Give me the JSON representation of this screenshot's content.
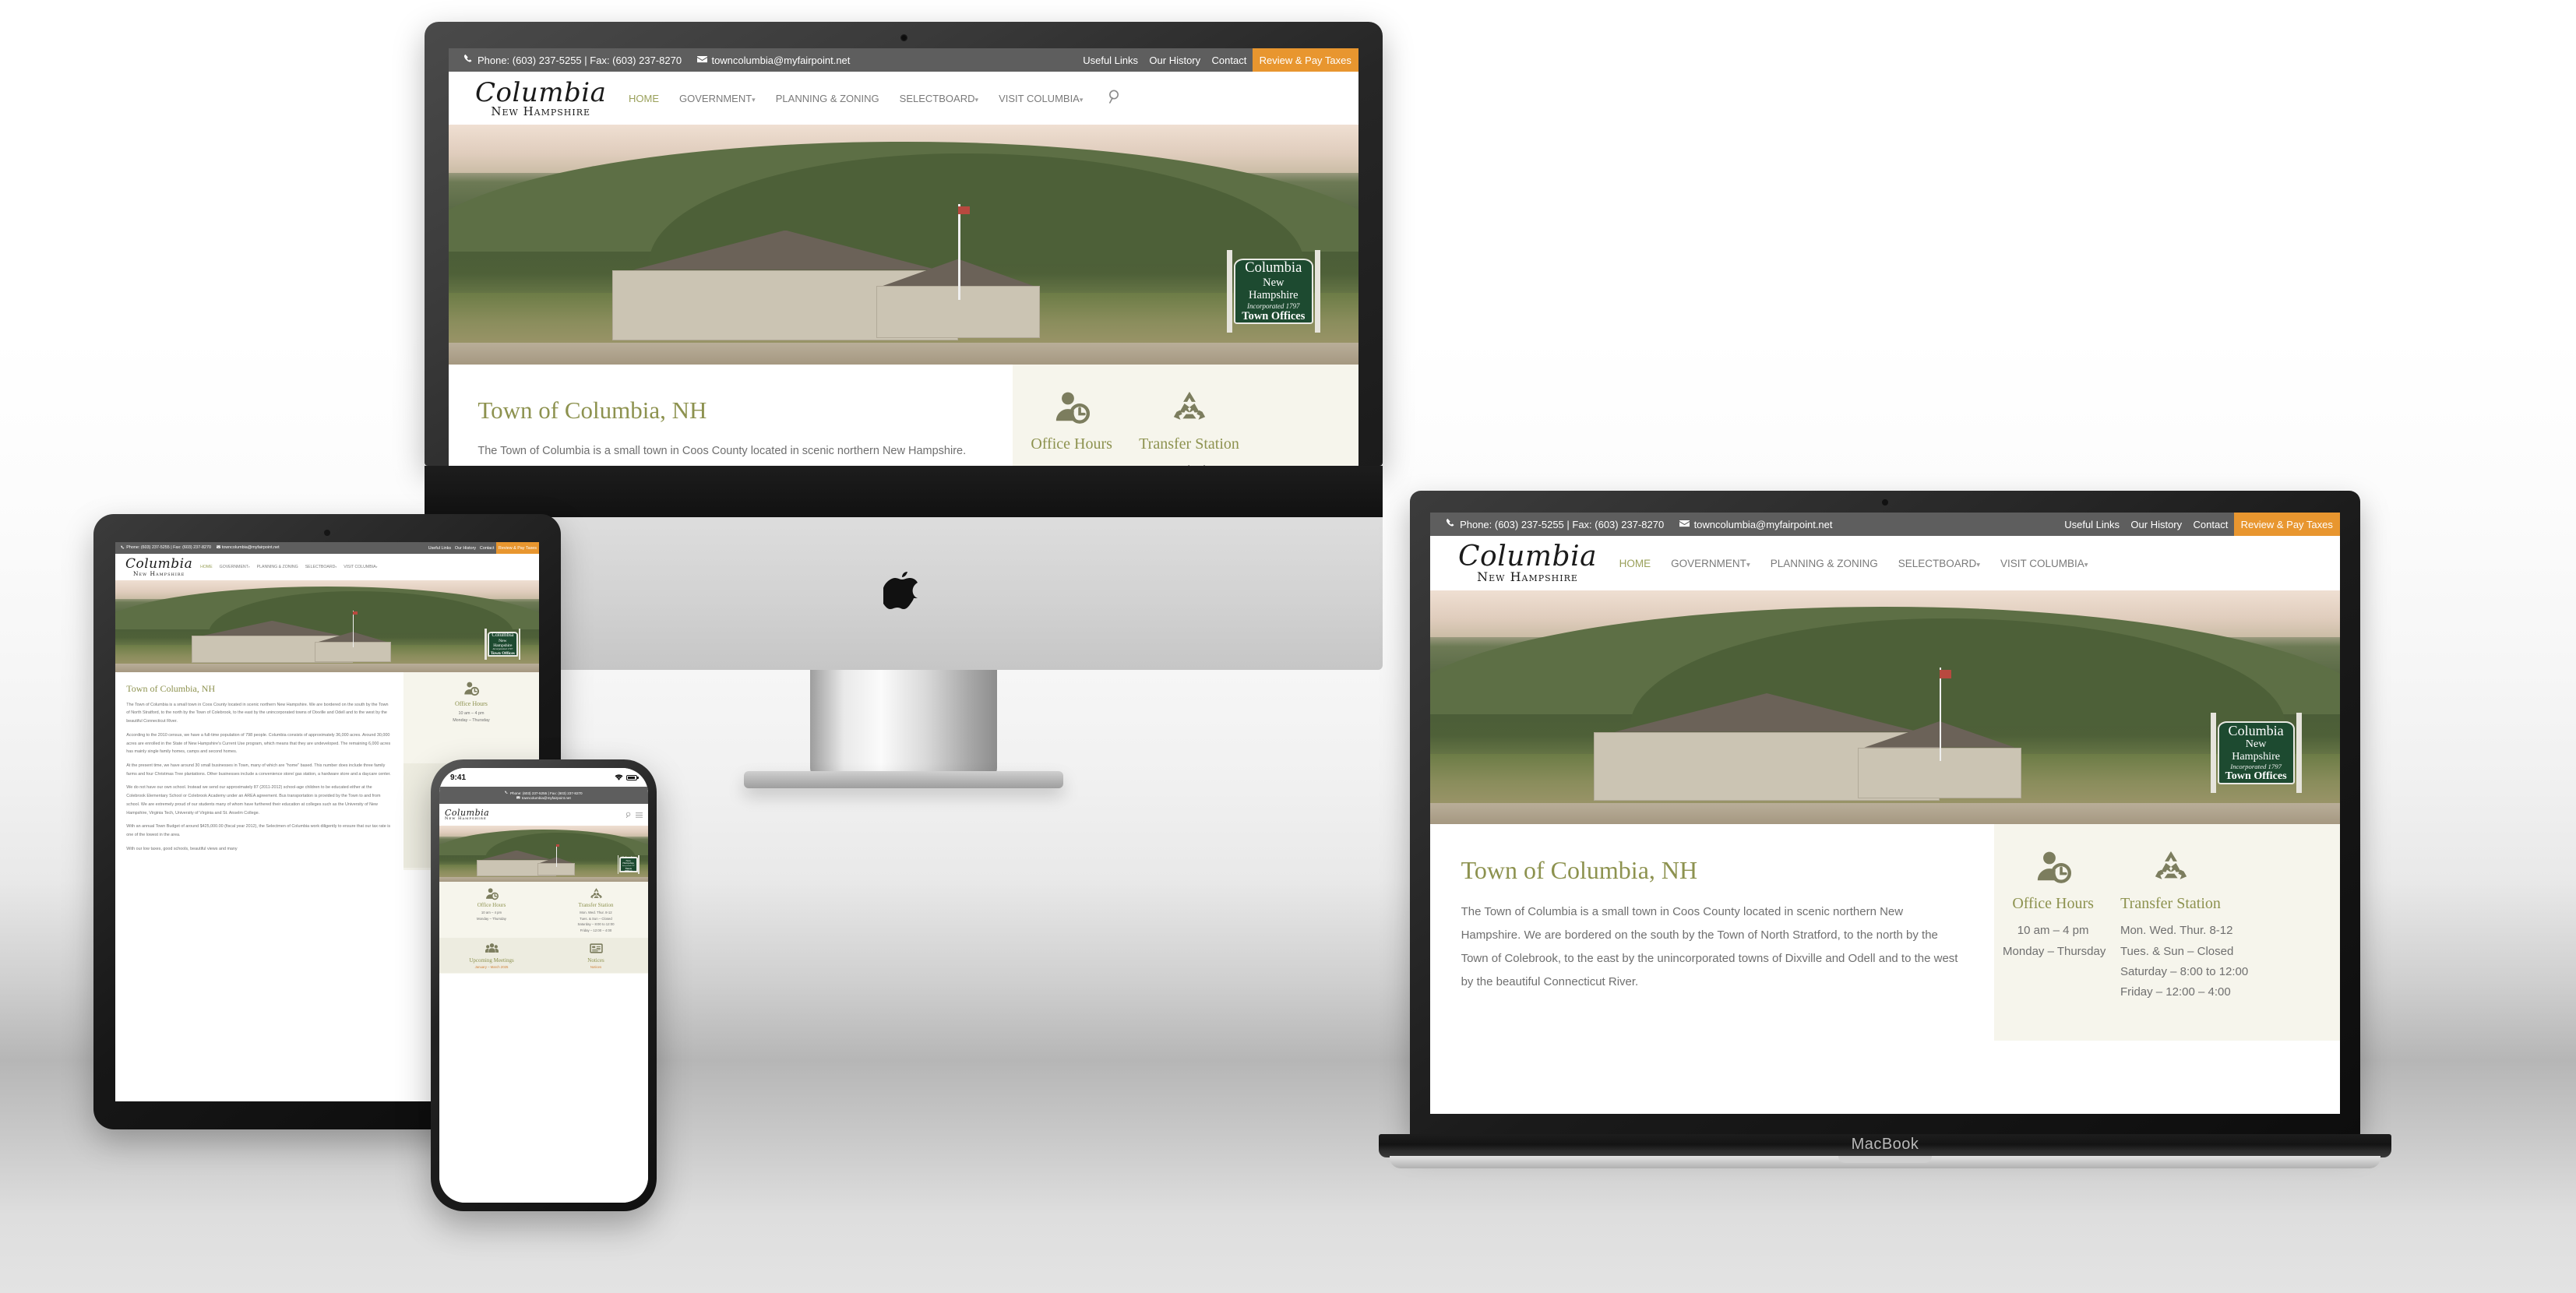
{
  "scene": {
    "devices": [
      "imac",
      "macbook",
      "tablet",
      "phone"
    ],
    "macbook_label": "MacBook",
    "phone_status": {
      "time": "9:41"
    }
  },
  "site": {
    "topbar": {
      "phone_icon": "phone-icon",
      "phone_text": "Phone: (603) 237-5255 | Fax: (603) 237-8270",
      "email_icon": "envelope-icon",
      "email_text": "towncolumbia@myfairpoint.net",
      "links": [
        "Useful Links",
        "Our History",
        "Contact"
      ],
      "cta_label": "Review & Pay Taxes",
      "cta_color": "#e8962f",
      "bg_color": "#5e5e5e"
    },
    "logo": {
      "line1": "Columbia",
      "line2": "New Hampshire"
    },
    "nav": {
      "items": [
        {
          "label": "HOME",
          "active": true,
          "caret": false
        },
        {
          "label": "GOVERNMENT",
          "active": false,
          "caret": true
        },
        {
          "label": "PLANNING & ZONING",
          "active": false,
          "caret": false
        },
        {
          "label": "SELECTBOARD",
          "active": false,
          "caret": true
        },
        {
          "label": "VISIT COLUMBIA",
          "active": false,
          "caret": true
        }
      ],
      "active_color": "#9aa05a",
      "search_icon": "search-icon"
    },
    "hero": {
      "sign": {
        "line1": "Columbia",
        "line2": "New Hampshire",
        "line3": "Incorporated 1797",
        "line4": "Town Offices",
        "color": "#1d4a30"
      }
    },
    "main": {
      "heading": "Town of Columbia, NH",
      "heading_color": "#8d924f",
      "paragraphs": [
        "The Town of Columbia is a small town in Coos County located in scenic northern New Hampshire. We are bordered on the south by the Town of North Stratford, to the north by the Town of Colebrook, to the east by the unincorporated towns of Dixville and Odell and to the west by the beautiful Connecticut River.",
        "According to the 2010 census, we have a full-time population of 798 people. Columbia consists of approximately 36,000 acres. Around 30,000 acres are enrolled in the State of New Hampshire's Current Use program, which means that they are undeveloped. The remaining 6,000 acres has mainly single family homes, camps and second homes.",
        "At the present time, we have around 30 small businesses in Town, many of which are \"home\" based. This number does include three family farms and four Christmas Tree plantations. Other businesses include a convenience store/ gas station, a hardware store and a daycare center.",
        "We do not have our own school. Instead we send our approximately 87 (2011-2012) school-age children to be educated either at the Colebrook Elementary School or Colebrook Academy under an AREA agreement. Bus transportation is provided by the Town to and from school. We are extremely proud of our students many of whom have furthered their education at colleges such as the University of New Hampshire, Virginia Tech, University of Virginia and St. Anselm College.",
        "With an annual Town Budget of around $425,000.00 (fiscal year 2012), the Selectmen of Columbia work diligently to ensure that our tax rate is one of the lowest in the area.",
        "With our low taxes, good schools, beautiful views and many"
      ]
    },
    "widgets": [
      {
        "icon": "person-clock-icon",
        "title": "Office Hours",
        "lines": [
          "10 am – 4 pm",
          "Monday – Thursday"
        ],
        "orange": null
      },
      {
        "icon": "recycle-icon",
        "title": "Transfer Station",
        "lines": [
          "Mon. Wed. Thur. 8-12",
          "Tues. & Sun – Closed",
          "Saturday – 8:00 to 12:00",
          "Friday – 12:00 – 4:00"
        ],
        "orange": null
      },
      {
        "icon": "people-group-icon",
        "title": "Upcoming Meetings",
        "lines": [],
        "orange": "January – March 2025"
      },
      {
        "icon": "list-document-icon",
        "title": "Notices",
        "lines": [],
        "orange": "Notices"
      }
    ]
  }
}
